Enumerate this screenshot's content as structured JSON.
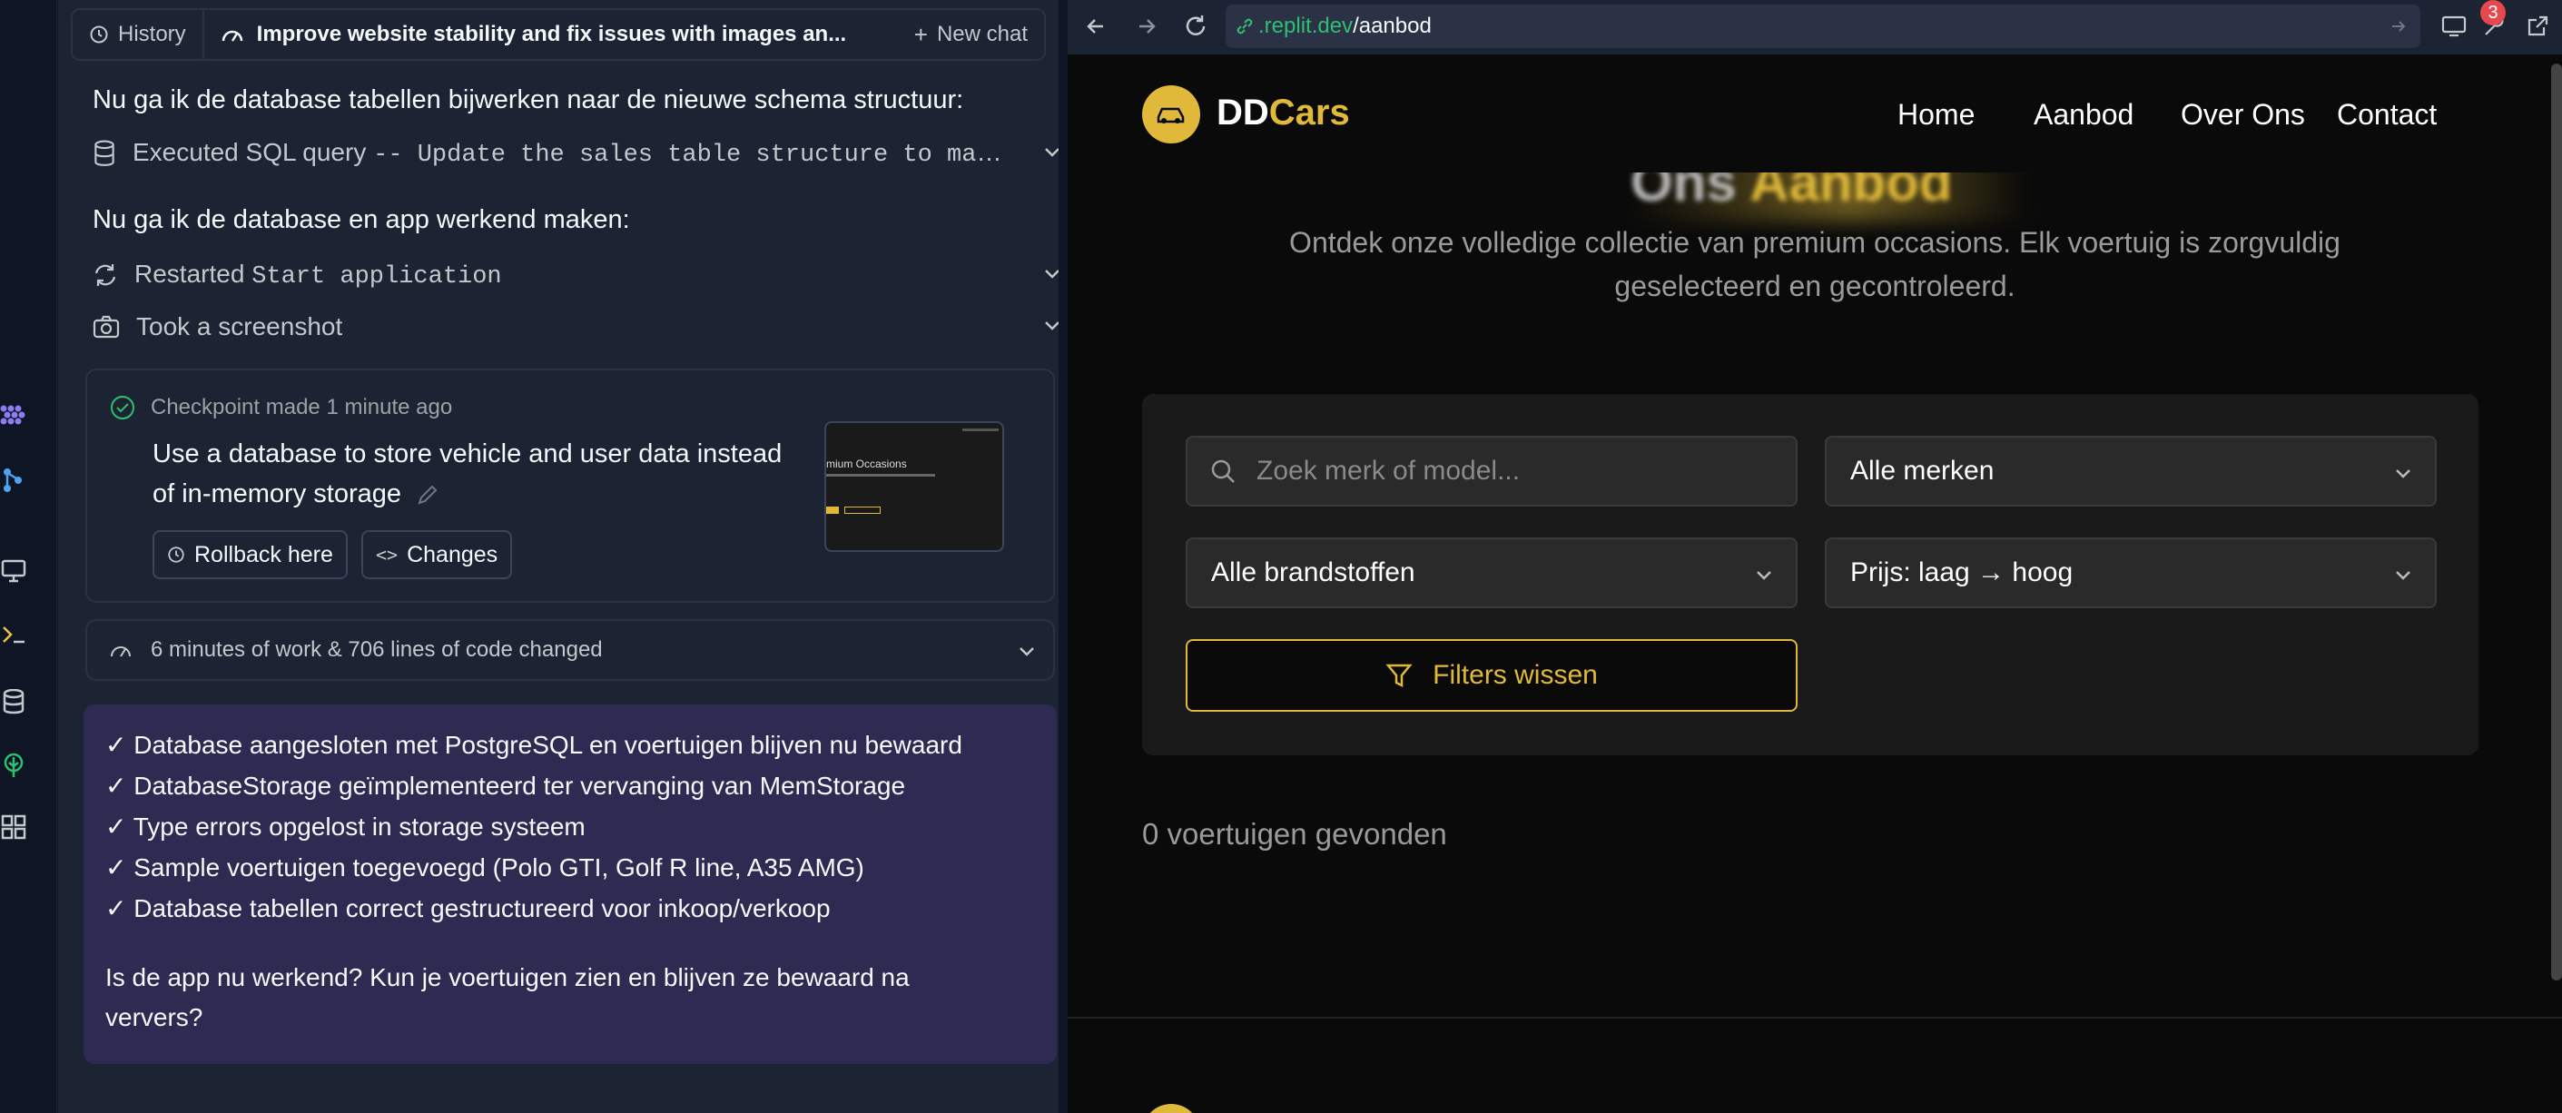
{
  "chat": {
    "history_label": "History",
    "title": "Improve website stability and fix issues with images an...",
    "new_chat_label": "New chat",
    "messages": [
      "Nu ga ik de database tabellen bijwerken naar de nieuwe schema structuur:",
      "Nu ga ik de database en app werkend maken:"
    ],
    "actions": [
      {
        "label": "Executed SQL query",
        "code": "-- Update the sales table structure to ma..."
      },
      {
        "label": "Restarted",
        "code": "Start application"
      },
      {
        "label": "Took a screenshot",
        "code": ""
      }
    ],
    "checkpoint": {
      "header": "Checkpoint made",
      "time": "1 minute ago",
      "text": "Use a database to store vehicle and user data instead of in-memory storage",
      "rollback_label": "Rollback here",
      "changes_label": "Changes",
      "thumb_text": "mium Occasions"
    },
    "work_summary": "6 minutes of work & 706 lines of code changed",
    "summary_lines": [
      "✓ Database aangesloten met PostgreSQL en voertuigen blijven nu bewaard",
      "✓ DatabaseStorage geïmplementeerd ter vervanging van MemStorage",
      "✓ Type errors opgelost in storage systeem",
      "✓ Sample voertuigen toegevoegd (Polo GTI, Golf R line, A35 AMG)",
      "✓ Database tabellen correct gestructureerd voor inkoop/verkoop"
    ],
    "question_line1": "Is de app nu werkend? Kun je voertuigen zien en blijven ze bewaard na",
    "question_line2": "ververs?"
  },
  "browser": {
    "url_host": ".replit.dev",
    "url_path": "/aanbod",
    "badge_count": "3"
  },
  "site": {
    "brand_part1": "DD",
    "brand_part2": "Cars",
    "nav": [
      "Home",
      "Aanbod",
      "Over Ons",
      "Contact"
    ],
    "hero_title_part1": "Ons",
    "hero_title_part2": "Aanbod",
    "hero_sub_line1": "Ontdek onze volledige collectie van premium occasions. Elk voertuig is zorgvuldig",
    "hero_sub_line2": "geselecteerd en gecontroleerd.",
    "search_placeholder": "Zoek merk of model...",
    "brand_select": "Alle merken",
    "fuel_select": "Alle brandstoffen",
    "sort_select": "Prijs: laag → hoog",
    "clear_label": "Filters wissen",
    "results": "0 voertuigen gevonden"
  },
  "colors": {
    "accent": "#e0b93a",
    "chat_bg": "#1c2333",
    "site_bg": "#0a0a0a",
    "summary_bg": "#2e2a52"
  }
}
